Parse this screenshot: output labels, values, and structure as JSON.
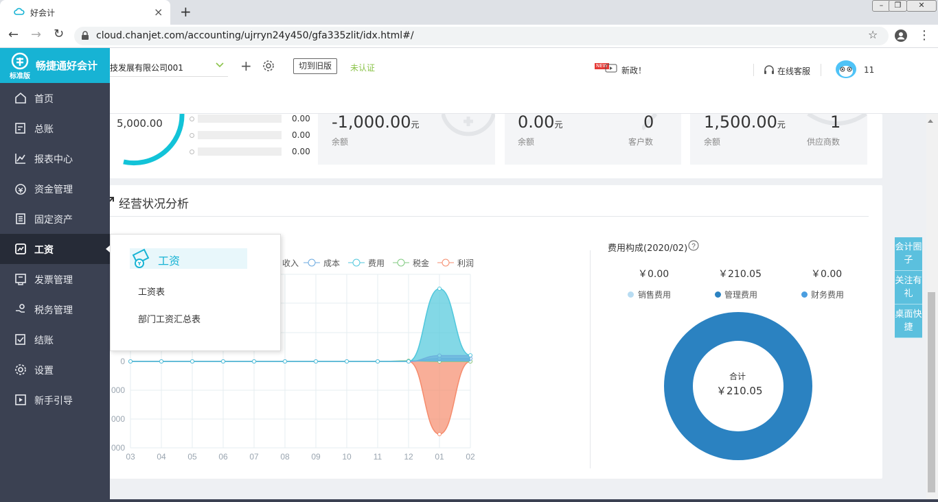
{
  "browser": {
    "tab_title": "好会计",
    "url": "cloud.chanjet.com/accounting/ujrryn24y450/gfa335zlit/idx.html#/"
  },
  "brand": {
    "name": "畅捷通好会计",
    "edition": "标准版"
  },
  "header": {
    "company": "技发展有限公司001",
    "switch_version": "切到旧版",
    "cert_status": "未认证",
    "news_badge": "NEW",
    "news_text": "新政！",
    "service": "在线客服",
    "user_count": "11"
  },
  "sidebar": {
    "items": [
      {
        "label": "首页"
      },
      {
        "label": "总账"
      },
      {
        "label": "报表中心"
      },
      {
        "label": "资金管理"
      },
      {
        "label": "固定资产"
      },
      {
        "label": "工资"
      },
      {
        "label": "发票管理"
      },
      {
        "label": "税务管理"
      },
      {
        "label": "结账"
      },
      {
        "label": "设置"
      },
      {
        "label": "新手引导"
      }
    ]
  },
  "flyout": {
    "title": "工资",
    "items": [
      "工资表",
      "部门工资汇总表"
    ]
  },
  "summary": {
    "ring_value": "5,000.00",
    "mini_rows": [
      "0.00",
      "0.00",
      "0.00"
    ],
    "cards": [
      {
        "amount": "-1,000.00",
        "unit": "元",
        "label": "余额"
      },
      {
        "amount": "0.00",
        "unit": "元",
        "label": "余额",
        "count": "0",
        "count_label": "客户数"
      },
      {
        "amount": "1,500.00",
        "unit": "元",
        "label": "余额",
        "count": "1",
        "count_label": "供应商数"
      }
    ]
  },
  "analysis": {
    "title": "经营状况分析"
  },
  "colors": {
    "cost": "#6aa9e0",
    "expense": "#4fc7dc",
    "tax": "#7fca7f",
    "profit": "#f58b6c",
    "income": "#b37fe0",
    "donut": "#2b82c1"
  },
  "chart_data": [
    {
      "type": "area",
      "legend": [
        "收入",
        "成本",
        "费用",
        "税金",
        "利润"
      ],
      "x": [
        "03",
        "04",
        "05",
        "06",
        "07",
        "08",
        "09",
        "10",
        "11",
        "12",
        "01",
        "02"
      ],
      "yticks": [
        "0",
        "000",
        "000",
        "000"
      ],
      "series": [
        {
          "name": "收入",
          "values": [
            0,
            0,
            0,
            0,
            0,
            0,
            0,
            0,
            0,
            0,
            200,
            200
          ]
        },
        {
          "name": "成本",
          "values": [
            0,
            0,
            0,
            0,
            0,
            0,
            0,
            0,
            0,
            0,
            100,
            100
          ]
        },
        {
          "name": "费用",
          "values": [
            0,
            0,
            0,
            0,
            0,
            0,
            0,
            0,
            0,
            0,
            2500,
            210.05
          ]
        },
        {
          "name": "税金",
          "values": [
            0,
            0,
            0,
            0,
            0,
            0,
            0,
            0,
            0,
            20,
            0,
            0
          ]
        },
        {
          "name": "利润",
          "values": [
            0,
            0,
            0,
            0,
            0,
            0,
            0,
            0,
            0,
            0,
            -2500,
            0
          ]
        }
      ]
    },
    {
      "type": "pie",
      "title": "费用构成(2020/02)",
      "values_display": [
        "￥0.00",
        "￥210.05",
        "￥0.00"
      ],
      "categories": [
        "销售费用",
        "管理费用",
        "财务费用"
      ],
      "values": [
        0,
        210.05,
        0
      ],
      "center_label": "合计",
      "center_value": "￥210.05"
    }
  ],
  "right_widget": [
    "会计圈子",
    "关注有礼",
    "桌面快捷"
  ]
}
